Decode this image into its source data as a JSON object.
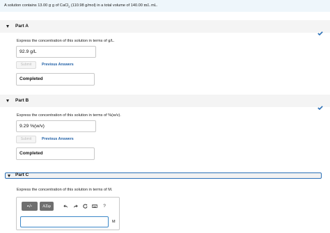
{
  "problem": {
    "lead": "A solution contains 13.00 ",
    "mass_unit": "g",
    "mid": " g of CaCl",
    "sub": "2",
    "tail": " (110.98 g/mol) in a total volume of 140.00 ",
    "vol_unit": "mL",
    "end": " mL."
  },
  "part_a": {
    "title": "Part A",
    "prompt": "Express the concentration of this solution in terms of g/L.",
    "answer": "92.9  g/L",
    "submit_label": "Submit",
    "previous_answers_label": "Previous Answers",
    "status": "Completed"
  },
  "part_b": {
    "title": "Part B",
    "prompt": "Express the concentration of this solution in terms of %(w/v).",
    "answer": "9.29  %(w/v)",
    "submit_label": "Submit",
    "previous_answers_label": "Previous Answers",
    "status": "Completed"
  },
  "part_c": {
    "title": "Part C",
    "prompt": "Express the concentration of this solution in terms of M.",
    "toolbar": {
      "template_label": "▪√▫",
      "symbols_label": "ΑΣφ",
      "undo_icon": "undo-icon",
      "redo_icon": "redo-icon",
      "reset_icon": "reset-icon",
      "keyboard_icon": "keyboard-icon",
      "help_label": "?"
    },
    "input_value": "",
    "unit": "M"
  },
  "colors": {
    "accent": "#2a6fb6",
    "check": "#2a6fb6",
    "link": "#1f5fa6"
  }
}
